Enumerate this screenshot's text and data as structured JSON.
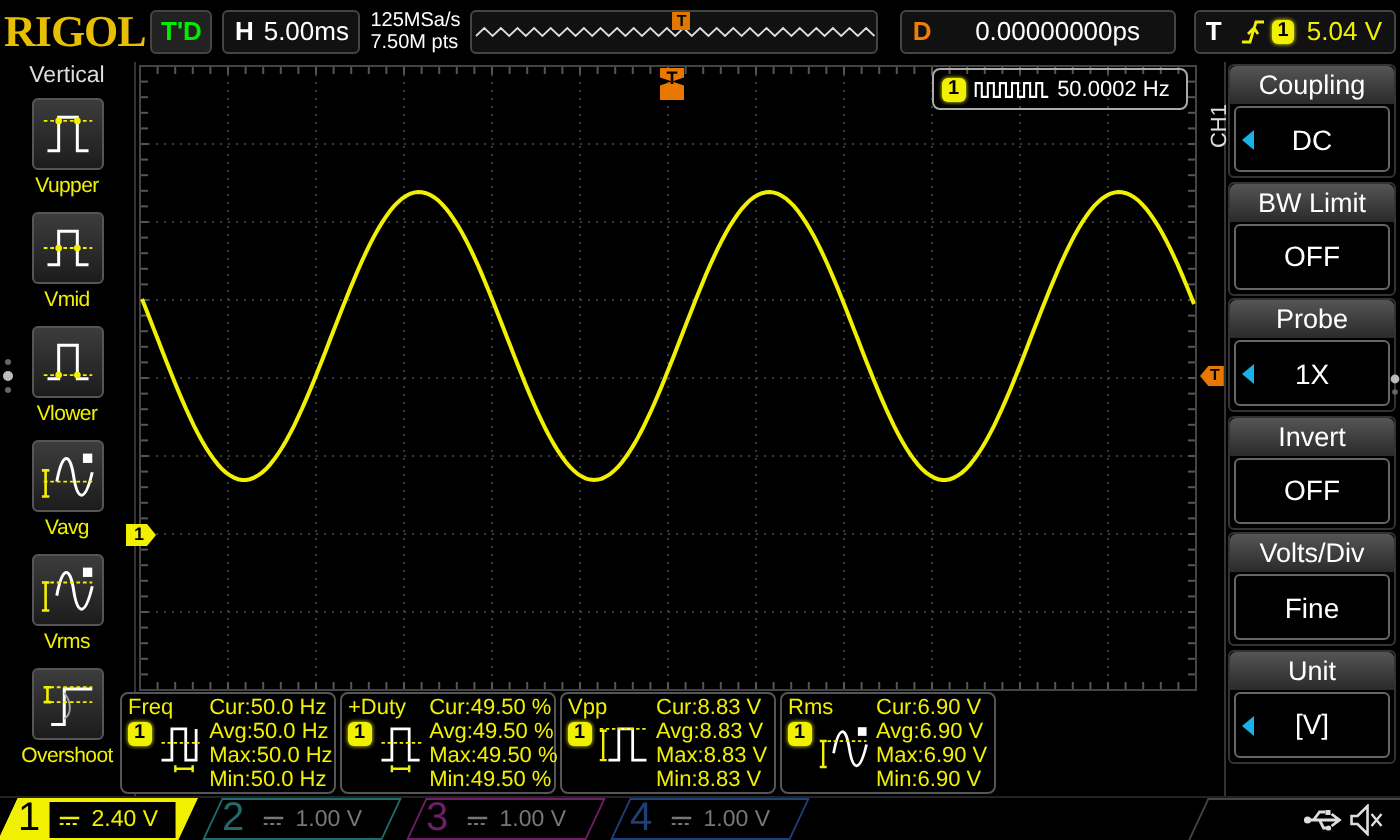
{
  "top_bar": {
    "logo": "RIGOL",
    "run_status": "T'D",
    "horizontal": {
      "label": "H",
      "timebase": "5.00ms",
      "sample_rate": "125MSa/s",
      "memory_depth": "7.50M pts"
    },
    "overview": {
      "marker": "T"
    },
    "delay": {
      "label": "D",
      "value": "0.00000000ps"
    },
    "trigger": {
      "label": "T",
      "source": "1",
      "level": "5.04 V"
    }
  },
  "sidebar": {
    "title": "Vertical",
    "items": [
      {
        "label": "Vupper",
        "kind": "upper"
      },
      {
        "label": "Vmid",
        "kind": "mid"
      },
      {
        "label": "Vlower",
        "kind": "lower"
      },
      {
        "label": "Vavg",
        "kind": "avg"
      },
      {
        "label": "Vrms",
        "kind": "rms"
      },
      {
        "label": "Overshoot",
        "kind": "overshoot"
      }
    ]
  },
  "plot": {
    "trigger_position_marker": "T",
    "channel_marker": "1",
    "counter": {
      "source": "1",
      "value": "50.0002 Hz"
    }
  },
  "menu": {
    "channel": "CH1",
    "trigger_level_marker": "T",
    "items": [
      {
        "title": "Coupling",
        "value": "DC",
        "arrow": true
      },
      {
        "title": "BW Limit",
        "value": "OFF",
        "arrow": false
      },
      {
        "title": "Probe",
        "value": "1X",
        "arrow": true
      },
      {
        "title": "Invert",
        "value": "OFF",
        "arrow": false
      },
      {
        "title": "Volts/Div",
        "value": "Fine",
        "arrow": false
      },
      {
        "title": "Unit",
        "value": "[V]",
        "arrow": true
      }
    ]
  },
  "measurements": [
    {
      "name": "Freq",
      "source": "1",
      "kind": "freq",
      "lines": [
        "Cur:50.0 Hz",
        "Avg:50.0 Hz",
        "Max:50.0 Hz",
        "Min:50.0 Hz"
      ]
    },
    {
      "name": "+Duty",
      "source": "1",
      "kind": "duty",
      "lines": [
        "Cur:49.50 %",
        "Avg:49.50 %",
        "Max:49.50 %",
        "Min:49.50 %"
      ]
    },
    {
      "name": "Vpp",
      "source": "1",
      "kind": "vpp",
      "lines": [
        "Cur:8.83 V",
        "Avg:8.83 V",
        "Max:8.83 V",
        "Min:8.83 V"
      ]
    },
    {
      "name": "Rms",
      "source": "1",
      "kind": "rms",
      "lines": [
        "Cur:6.90 V",
        "Avg:6.90 V",
        "Max:6.90 V",
        "Min:6.90 V"
      ]
    }
  ],
  "channels": [
    {
      "number": "1",
      "scale": "2.40 V",
      "selected": true,
      "color": "#f0f000"
    },
    {
      "number": "2",
      "scale": "1.00 V",
      "selected": false,
      "color": "#1f6a6a"
    },
    {
      "number": "3",
      "scale": "1.00 V",
      "selected": false,
      "color": "#6e1f66"
    },
    {
      "number": "4",
      "scale": "1.00 V",
      "selected": false,
      "color": "#1f3f78"
    }
  ]
}
